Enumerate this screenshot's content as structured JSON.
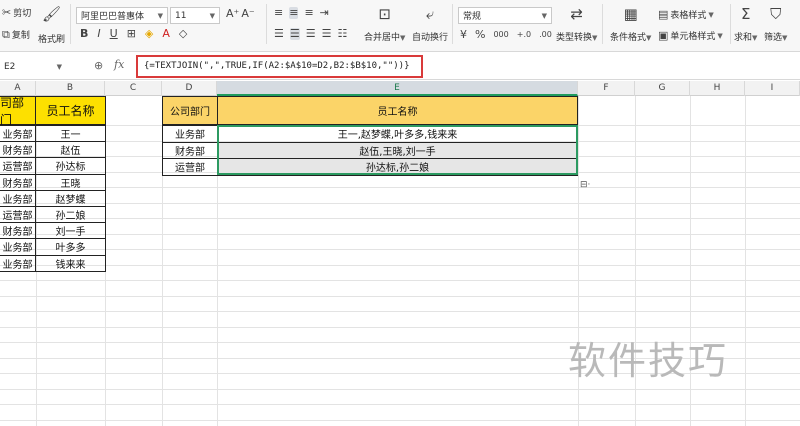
{
  "toolbar": {
    "cut": "剪切",
    "copy": "复制",
    "format_painter": "格式刷",
    "font_name": "阿里巴巴普惠体",
    "font_size": "11",
    "bold": "B",
    "italic": "I",
    "underline": "U",
    "grow_font": "A⁺",
    "shrink_font": "A⁻",
    "merge_center": "合并居中",
    "auto_wrap": "自动换行",
    "number_format": "常规",
    "currency": "¥",
    "percent": "%",
    "thousands": "000",
    "inc_decimal": "+.0",
    "dec_decimal": ".00",
    "type_convert": "类型转换",
    "conditional_format": "条件格式",
    "table_style": "表格样式",
    "cell_style": "单元格样式",
    "sum": "求和",
    "filter": "筛选"
  },
  "formula_bar": {
    "name_box": "E2",
    "fx": "fx",
    "formula": "{=TEXTJOIN(\",\",TRUE,IF(A2:$A$10=D2,B2:$B$10,\"\"))}"
  },
  "columns": [
    "A",
    "B",
    "C",
    "D",
    "E",
    "F",
    "G",
    "H",
    "I"
  ],
  "left_table": {
    "header_a": "司部门",
    "header_b": "员工名称",
    "rows": [
      {
        "a": "业务部",
        "b": "王一"
      },
      {
        "a": "财务部",
        "b": "赵伍"
      },
      {
        "a": "运营部",
        "b": "孙达标"
      },
      {
        "a": "财务部",
        "b": "王晓"
      },
      {
        "a": "业务部",
        "b": "赵梦蝶"
      },
      {
        "a": "运营部",
        "b": "孙二娘"
      },
      {
        "a": "财务部",
        "b": "刘一手"
      },
      {
        "a": "业务部",
        "b": "叶多多"
      },
      {
        "a": "业务部",
        "b": "钱来来"
      }
    ]
  },
  "result_table": {
    "header_d": "公司部门",
    "header_e": "员工名称",
    "rows": [
      {
        "d": "业务部",
        "e": "王一,赵梦蝶,叶多多,钱来来"
      },
      {
        "d": "财务部",
        "e": "赵伍,王晓,刘一手"
      },
      {
        "d": "运营部",
        "e": "孙达标,孙二娘"
      }
    ]
  },
  "paste_options": "⊟·",
  "watermark": "软件技巧",
  "colors": {
    "yellow_header": "#fde000",
    "orange_header": "#fbd468",
    "selection_green": "#2c9a61",
    "formula_highlight": "#d93a3a"
  }
}
